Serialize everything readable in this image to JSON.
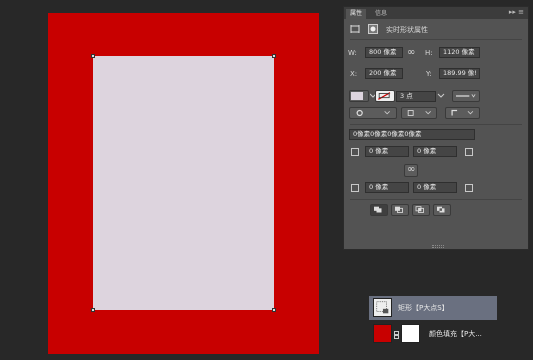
{
  "panel": {
    "tabs": [
      "属性",
      "信息"
    ],
    "tab_arrows": "▸▸ ≡",
    "title": "实时形状属性",
    "w_label": "W:",
    "w_value": "800 像素",
    "h_label": "H:",
    "h_value": "1120 像素",
    "x_label": "X:",
    "x_value": "200 像素",
    "y_label": "Y:",
    "y_value": "189.99 像!",
    "link_glyph": "∞",
    "stroke_width": "3 点",
    "corner_radii": "0像素0像素0像素0像素",
    "corner_tl": "0 像素",
    "corner_tr": "0 像素",
    "corner_bl": "0 像素",
    "corner_br": "0 像素",
    "colors": {
      "fill_swatch": "#ddd4de",
      "canvas_red": "#c80000",
      "inner": "#ddd4de"
    }
  },
  "layers": {
    "rows": [
      {
        "name": "矩形【P大点S】",
        "selected": true
      },
      {
        "name": "颜色填充【P大...",
        "selected": false
      }
    ]
  }
}
